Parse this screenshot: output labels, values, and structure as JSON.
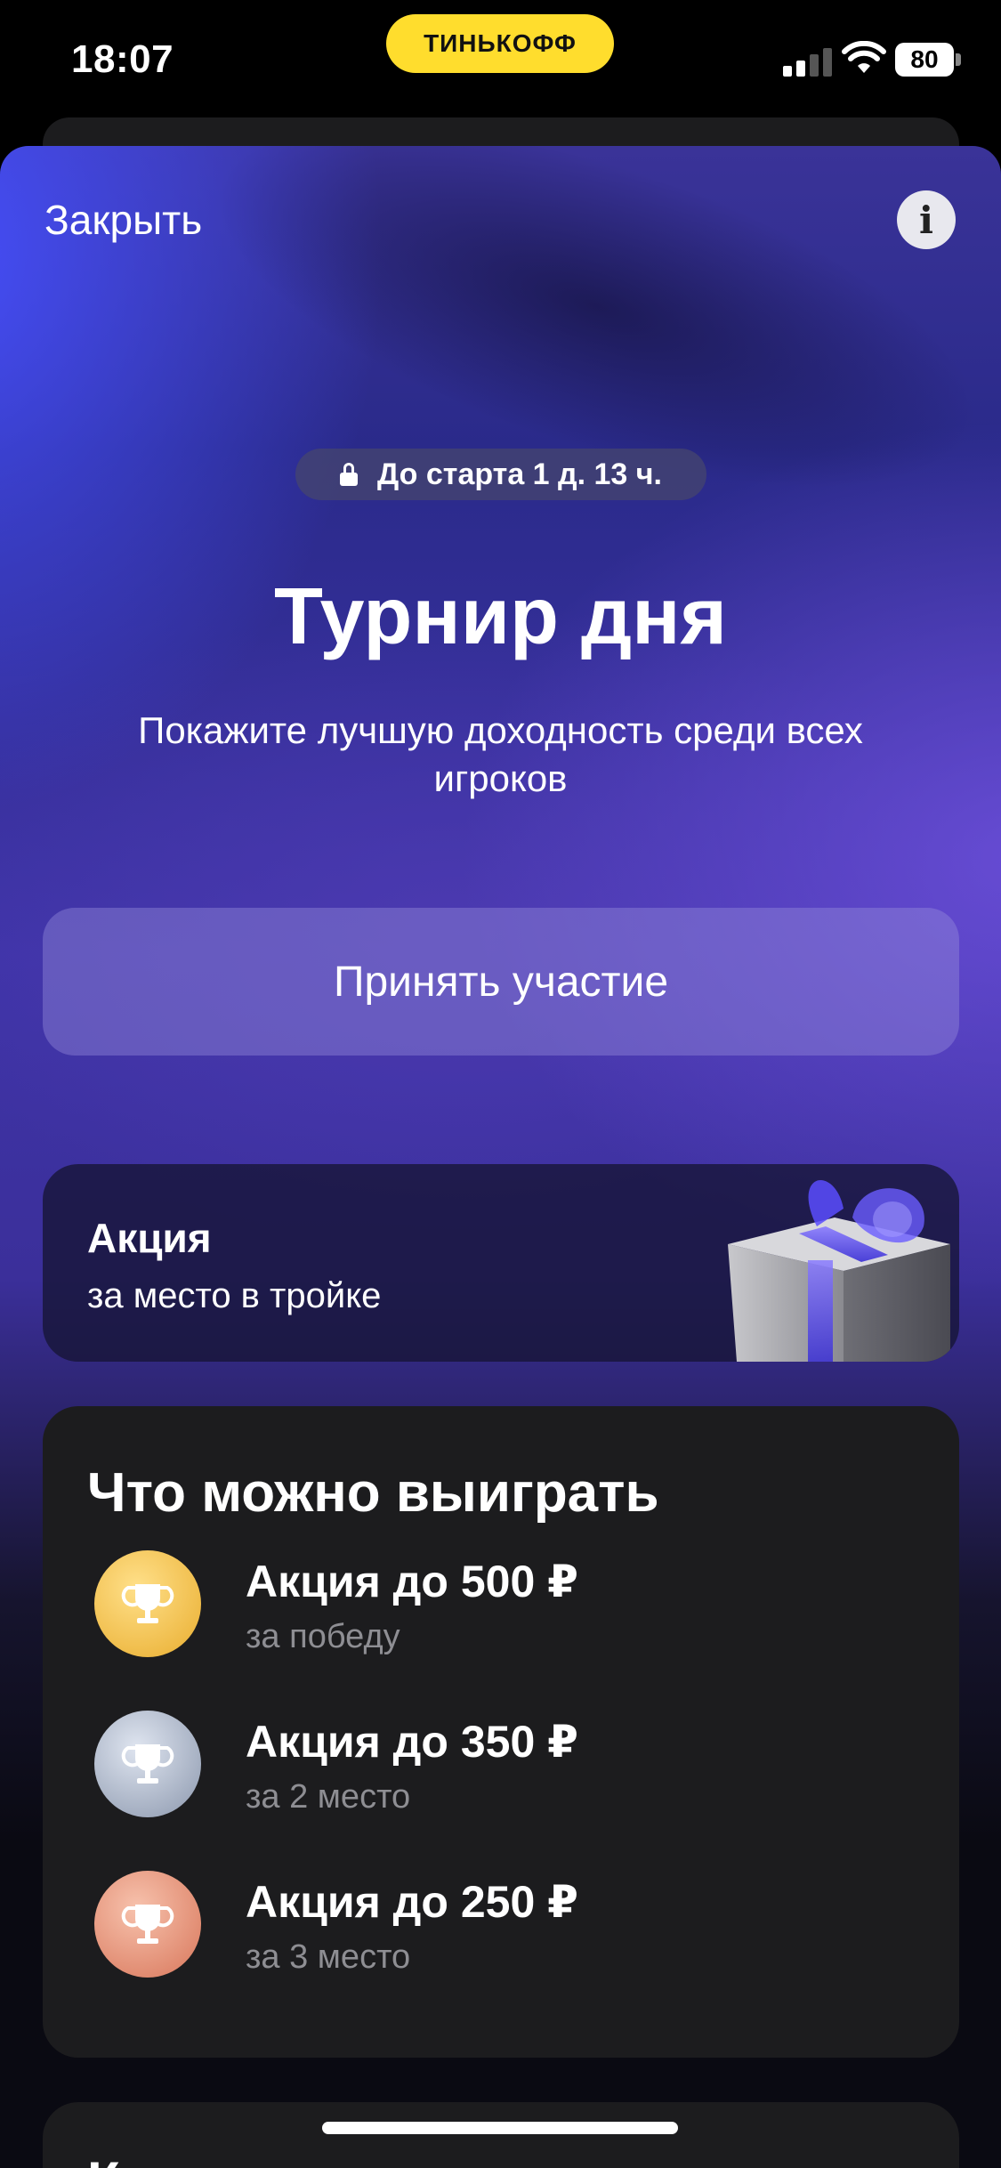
{
  "status_bar": {
    "time": "18:07",
    "brand": "ТИНЬКОФФ",
    "battery": "80"
  },
  "sheet": {
    "close_label": "Закрыть",
    "info_icon": "i",
    "start_badge": "До старта 1 д. 13 ч.",
    "title": "Турнир дня",
    "subtitle": "Покажите лучшую доходность среди всех игроков",
    "cta_label": "Принять участие"
  },
  "promo": {
    "title": "Акция",
    "subtitle": "за место в тройке",
    "icon": "gift-icon"
  },
  "prizes": {
    "title": "Что можно выиграть",
    "items": [
      {
        "amount": "Акция до 500 ₽",
        "desc": "за победу",
        "color": "#f2c14e"
      },
      {
        "amount": "Акция до 350 ₽",
        "desc": "за 2 место",
        "color": "#a9b4c8"
      },
      {
        "amount": "Акция до 250 ₽",
        "desc": "за 3 место",
        "color": "#e99a7e"
      }
    ]
  },
  "next_section": {
    "title": "Ка  "
  },
  "colors": {
    "brand_yellow": "#ffdd2d",
    "card_bg": "#1c1c1e",
    "gold": "#f2c14e",
    "silver": "#a9b4c8",
    "bronze": "#e99a7e"
  }
}
